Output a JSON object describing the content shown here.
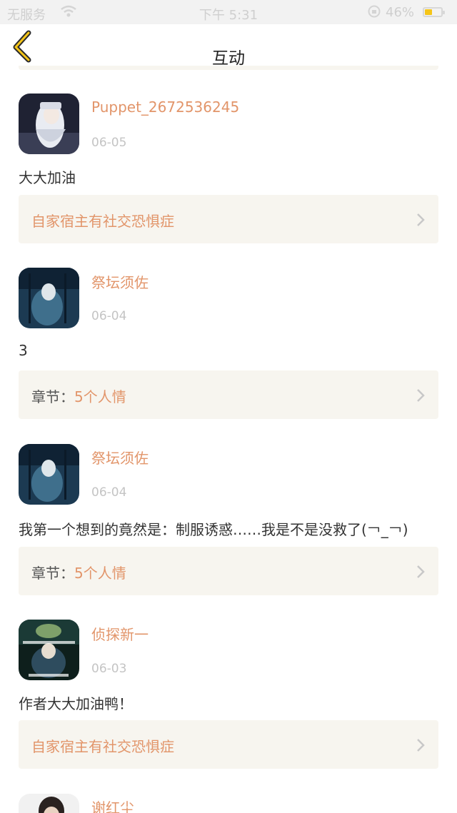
{
  "status_bar": {
    "carrier": "无服务",
    "time": "下午 5:31",
    "battery_pct": "46%",
    "battery_level": 0.46
  },
  "nav": {
    "title": "互动",
    "back_icon": "chevron-left-icon"
  },
  "colors": {
    "accent": "#e2956a",
    "card_bg": "#f7f5ef",
    "date": "#c4c4c4",
    "back_chevron": "#f5c518"
  },
  "comments": [
    {
      "username": "Puppet_2672536245",
      "date": "06-05",
      "text": "大大加油",
      "ref_prefix": "",
      "ref_title": "自家宿主有社交恐惧症"
    },
    {
      "username": "祭坛须佐",
      "date": "06-04",
      "text": "3",
      "ref_prefix": "章节：",
      "ref_title": "5个人情"
    },
    {
      "username": "祭坛须佐",
      "date": "06-04",
      "text": "我第一个想到的竟然是：制服诱惑……我是不是没救了(￢_￢)",
      "ref_prefix": "章节：",
      "ref_title": "5个人情"
    },
    {
      "username": "侦探新一",
      "date": "06-03",
      "text": "作者大大加油鸭！",
      "ref_prefix": "",
      "ref_title": "自家宿主有社交恐惧症"
    },
    {
      "username": "谢红尘"
    }
  ]
}
